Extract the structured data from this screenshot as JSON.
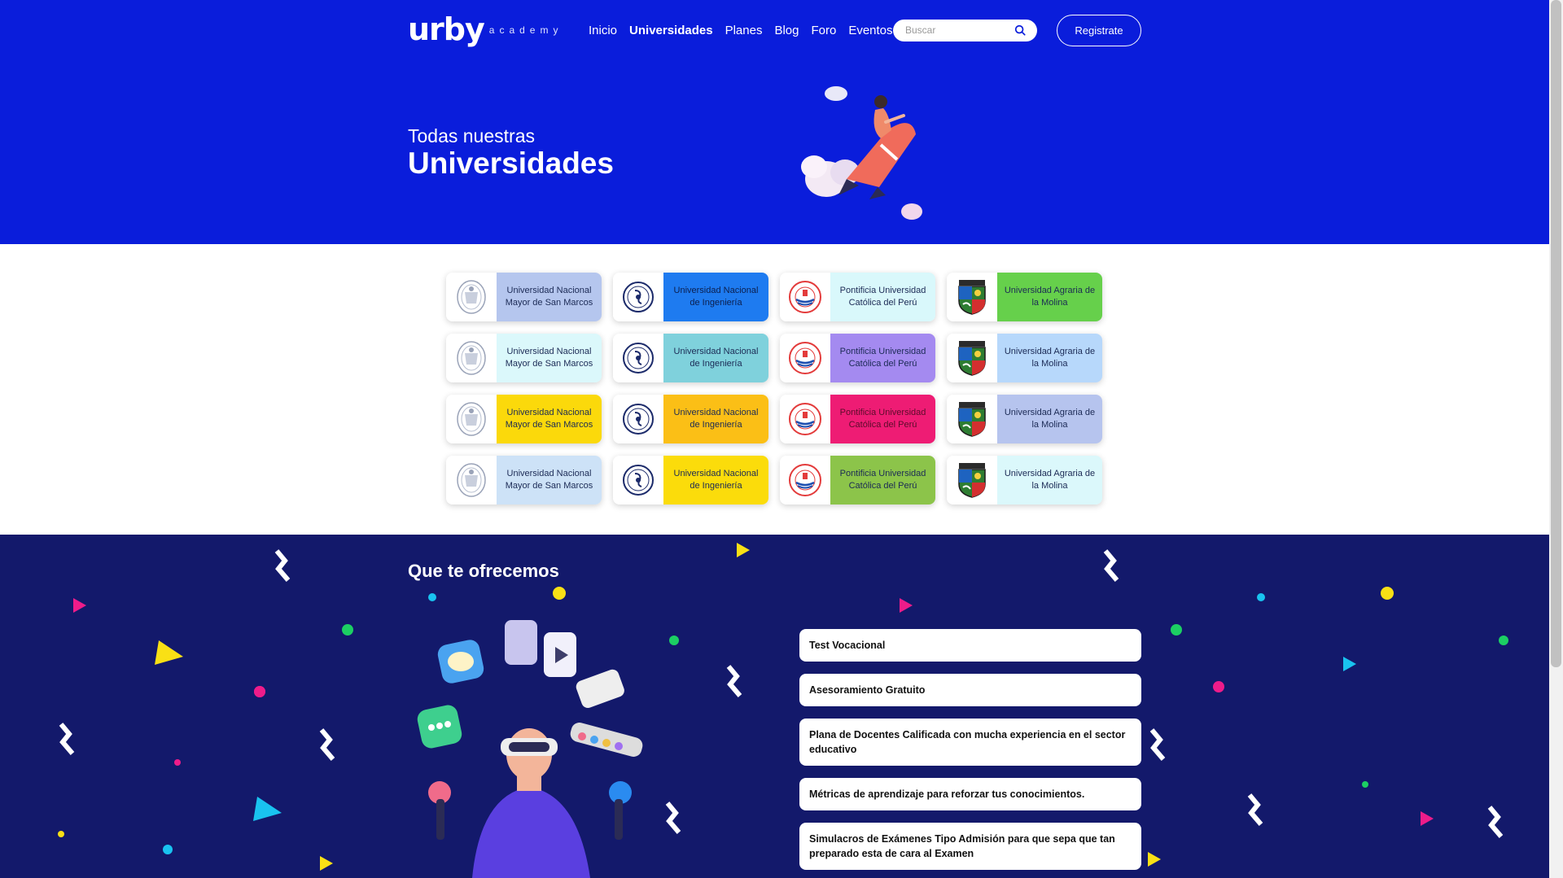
{
  "header": {
    "logo_text": "urby",
    "logo_sub": "academy",
    "nav": [
      "Inicio",
      "Universidades",
      "Planes",
      "Blog",
      "Foro",
      "Eventos"
    ],
    "nav_active": "Universidades",
    "search_placeholder": "Buscar",
    "register_label": "Registrate"
  },
  "hero": {
    "subtitle": "Todas nuestras",
    "title": "Universidades"
  },
  "universities": [
    {
      "name": "Universidad Nacional Mayor de San Marcos",
      "logo": "unmsm-seal-icon",
      "bg": "#b5c6ee",
      "fg": "#1b2a55"
    },
    {
      "name": "Universidad Nacional de Ingeniería",
      "logo": "uni-seal-icon",
      "bg": "#1e7bf0",
      "fg": "#0c1f4d"
    },
    {
      "name": "Pontificia Universidad Católica del Perú",
      "logo": "pucp-seal-icon",
      "bg": "#d9f8fb",
      "fg": "#1b2a55"
    },
    {
      "name": "Universidad Agraria de la Molina",
      "logo": "unalm-shield-icon",
      "bg": "#66d04b",
      "fg": "#1b2a55"
    },
    {
      "name": "Universidad Nacional Mayor de San Marcos",
      "logo": "unmsm-seal-icon",
      "bg": "#dbf8fb",
      "fg": "#1b2a55"
    },
    {
      "name": "Universidad Nacional de Ingeniería",
      "logo": "uni-seal-icon",
      "bg": "#7fd1dc",
      "fg": "#1b2a55"
    },
    {
      "name": "Pontificia Universidad Católica del Perú",
      "logo": "pucp-seal-icon",
      "bg": "#a48af0",
      "fg": "#1b2a55"
    },
    {
      "name": "Universidad Agraria de la Molina",
      "logo": "unalm-shield-icon",
      "bg": "#b7d8fb",
      "fg": "#1b2a55"
    },
    {
      "name": "Universidad Nacional Mayor de San Marcos",
      "logo": "unmsm-seal-icon",
      "bg": "#fbd90b",
      "fg": "#1b2a55"
    },
    {
      "name": "Universidad Nacional de Ingeniería",
      "logo": "uni-seal-icon",
      "bg": "#fbbf16",
      "fg": "#1b2a55"
    },
    {
      "name": "Pontificia Universidad Católica del Perú",
      "logo": "pucp-seal-icon",
      "bg": "#ee1c74",
      "fg": "#5a0c2a"
    },
    {
      "name": "Universidad Agraria de la Molina",
      "logo": "unalm-shield-icon",
      "bg": "#b6c4ee",
      "fg": "#1b2a55"
    },
    {
      "name": "Universidad Nacional Mayor de San Marcos",
      "logo": "unmsm-seal-icon",
      "bg": "#cde2f7",
      "fg": "#1b2a55"
    },
    {
      "name": "Universidad Nacional de Ingeniería",
      "logo": "uni-seal-icon",
      "bg": "#fbdc0b",
      "fg": "#1b2a55"
    },
    {
      "name": "Pontificia Universidad Católica del Perú",
      "logo": "pucp-seal-icon",
      "bg": "#8cc44a",
      "fg": "#1b2a55"
    },
    {
      "name": "Universidad Agraria de la Molina",
      "logo": "unalm-shield-icon",
      "bg": "#dbf8fb",
      "fg": "#1b2a55"
    }
  ],
  "offers": {
    "title": "Que te ofrecemos",
    "items": [
      "Test Vocacional",
      "Asesoramiento Gratuito",
      "Plana de Docentes Calificada con mucha experiencia en el sector educativo",
      "Métricas de aprendizaje para reforzar tus conocimientos.",
      "Simulacros de Exámenes Tipo Admisión para que sepa que tan preparado esta de cara al Examen"
    ]
  },
  "colors": {
    "hero_bg": "#0a1ddb",
    "offers_bg": "#13196b",
    "confetti": [
      "#ffffff",
      "#f9e015",
      "#19c3f0",
      "#1ccf63",
      "#ee1c8a"
    ]
  }
}
